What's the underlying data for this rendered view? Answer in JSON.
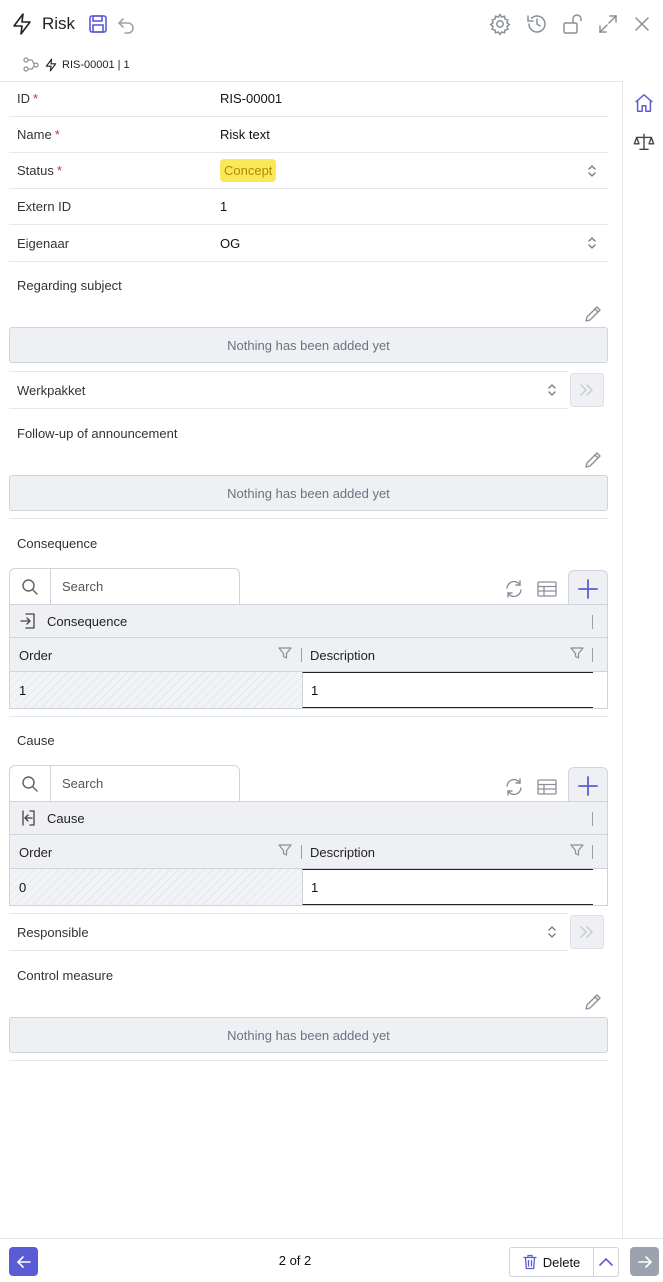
{
  "header": {
    "title": "Risk",
    "breadcrumb": "RIS-00001 | 1",
    "icons": [
      "lightning-icon",
      "save-icon",
      "undo-icon",
      "settings-icon",
      "history-icon",
      "unlock-icon",
      "expand-icon",
      "close-icon"
    ],
    "accent": "#5b5bd6"
  },
  "fields": [
    {
      "label": "ID",
      "value": "RIS-00001"
    },
    {
      "label": "Name",
      "value": "Risk text"
    },
    {
      "label": "Status",
      "value": "Concept"
    },
    {
      "label": "Extern ID",
      "value": "1"
    },
    {
      "label": "Eigenaar",
      "value": "OG"
    }
  ],
  "required_mark": "*",
  "regarding": {
    "label": "Regarding subject",
    "empty": "Nothing has been added yet"
  },
  "werkpakket": {
    "label": "Werkpakket"
  },
  "followup": {
    "label": "Follow-up of announcement",
    "empty": "Nothing has been added yet"
  },
  "consequence": {
    "label": "Consequence",
    "search_placeholder": "Search",
    "grid_title": "Consequence",
    "columns": [
      "Order",
      "Description"
    ],
    "rows": [
      [
        "1",
        "1"
      ]
    ]
  },
  "cause": {
    "label": "Cause",
    "search_placeholder": "Search",
    "grid_title": "Cause",
    "columns": [
      "Order",
      "Description"
    ],
    "rows": [
      [
        "0",
        "1"
      ]
    ]
  },
  "responsible": {
    "label": "Responsible"
  },
  "control": {
    "label": "Control measure",
    "empty": "Nothing has been added yet"
  },
  "footer": {
    "pager": "2 of 2",
    "delete_label": "Delete"
  },
  "colors": {
    "status_badge_bg": "#fbe85a",
    "status_badge_text": "#b08a00",
    "accent": "#5b5bd6"
  }
}
